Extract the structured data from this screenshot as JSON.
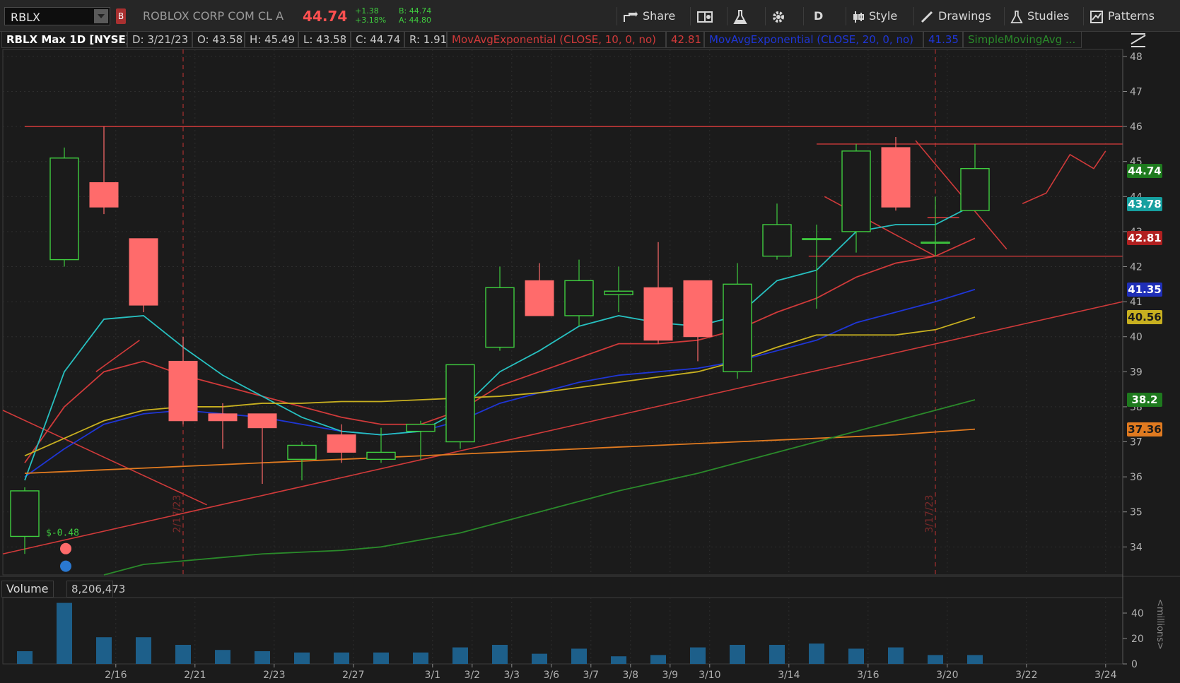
{
  "header": {
    "symbol": "RBLX",
    "badge": "B",
    "company": "ROBLOX CORP COM CL A",
    "last": "44.74",
    "change_abs": "+1.38",
    "change_pct": "+3.18%",
    "bid": "B: 44.74",
    "ask": "A: 44.80",
    "share_label": "Share",
    "period_label": "D",
    "style_label": "Style",
    "drawings_label": "Drawings",
    "studies_label": "Studies",
    "patterns_label": "Patterns"
  },
  "info": {
    "title": "RBLX Max 1D [NYSE]",
    "date": "D: 3/21/23",
    "open": "O: 43.58",
    "high": "H: 45.49",
    "low": "L: 43.58",
    "close": "C: 44.74",
    "range": "R: 1.91",
    "ema10": "MovAvgExponential (CLOSE, 10, 0, no)",
    "ema10_val": "42.81",
    "ema20": "MovAvgExponential (CLOSE, 20, 0, no)",
    "ema20_val": "41.35",
    "sma": "SimpleMovingAvg ..."
  },
  "volume": {
    "label": "Volume",
    "value": "8,206,473",
    "unit": "<millions>"
  },
  "colors": {
    "up": "#3fcc3f",
    "down": "#ff6b6b",
    "ema10": "#d03a3a",
    "ema20": "#1f36d6",
    "cyan": "#27c0c0",
    "sma_yellow": "#c8b020",
    "sma_orange": "#e07a20",
    "sma_green": "#2a8a2a",
    "volume": "#1d5f8a"
  },
  "chart_data": {
    "type": "candlestick",
    "ylim": [
      33.2,
      48.2
    ],
    "y_ticks": [
      34,
      35,
      36,
      37,
      38,
      39,
      40,
      41,
      42,
      43,
      44,
      45,
      46,
      47,
      48
    ],
    "x_labels": [
      {
        "i": 2.3,
        "label": "2/16"
      },
      {
        "i": 4.3,
        "label": "2/21"
      },
      {
        "i": 6.3,
        "label": "2/23"
      },
      {
        "i": 8.3,
        "label": "2/27"
      },
      {
        "i": 10.3,
        "label": "3/1"
      },
      {
        "i": 11.3,
        "label": "3/2"
      },
      {
        "i": 12.3,
        "label": "3/3"
      },
      {
        "i": 13.3,
        "label": "3/6"
      },
      {
        "i": 14.3,
        "label": "3/7"
      },
      {
        "i": 15.3,
        "label": "3/8"
      },
      {
        "i": 16.3,
        "label": "3/9"
      },
      {
        "i": 17.3,
        "label": "3/10"
      },
      {
        "i": 19.3,
        "label": "3/14"
      },
      {
        "i": 21.3,
        "label": "3/16"
      },
      {
        "i": 23.3,
        "label": "3/20"
      },
      {
        "i": 25.3,
        "label": "3/22"
      },
      {
        "i": 27.3,
        "label": "3/24"
      }
    ],
    "candles": [
      {
        "o": 34.3,
        "h": 35.7,
        "l": 33.8,
        "c": 35.6
      },
      {
        "o": 42.2,
        "h": 45.4,
        "l": 42.0,
        "c": 45.1
      },
      {
        "o": 44.4,
        "h": 46.0,
        "l": 43.5,
        "c": 43.7
      },
      {
        "o": 42.8,
        "h": 42.8,
        "l": 40.7,
        "c": 40.9
      },
      {
        "o": 39.3,
        "h": 40.0,
        "l": 37.5,
        "c": 37.6
      },
      {
        "o": 37.8,
        "h": 38.1,
        "l": 36.8,
        "c": 37.6
      },
      {
        "o": 37.8,
        "h": 37.8,
        "l": 35.8,
        "c": 37.4
      },
      {
        "o": 36.5,
        "h": 37.0,
        "l": 35.9,
        "c": 36.9
      },
      {
        "o": 37.2,
        "h": 37.5,
        "l": 36.4,
        "c": 36.7
      },
      {
        "o": 36.5,
        "h": 37.4,
        "l": 36.4,
        "c": 36.7
      },
      {
        "o": 37.3,
        "h": 37.6,
        "l": 36.5,
        "c": 37.5
      },
      {
        "o": 37.0,
        "h": 39.2,
        "l": 36.8,
        "c": 39.2
      },
      {
        "o": 39.7,
        "h": 42.0,
        "l": 39.6,
        "c": 41.4
      },
      {
        "o": 41.6,
        "h": 42.1,
        "l": 40.6,
        "c": 40.6
      },
      {
        "o": 40.6,
        "h": 42.2,
        "l": 40.3,
        "c": 41.6
      },
      {
        "o": 41.2,
        "h": 42.0,
        "l": 40.7,
        "c": 41.3
      },
      {
        "o": 41.4,
        "h": 42.7,
        "l": 39.8,
        "c": 39.9
      },
      {
        "o": 41.6,
        "h": 41.6,
        "l": 39.3,
        "c": 40.0
      },
      {
        "o": 39.0,
        "h": 42.1,
        "l": 38.8,
        "c": 41.5
      },
      {
        "o": 42.3,
        "h": 43.8,
        "l": 42.2,
        "c": 43.2
      },
      {
        "o": 42.8,
        "h": 43.2,
        "l": 40.8,
        "c": 42.8
      },
      {
        "o": 43.0,
        "h": 45.5,
        "l": 42.4,
        "c": 45.3
      },
      {
        "o": 45.4,
        "h": 45.7,
        "l": 43.6,
        "c": 43.7
      },
      {
        "o": 42.7,
        "h": 44.0,
        "l": 42.3,
        "c": 42.7
      },
      {
        "o": 43.6,
        "h": 45.5,
        "l": 43.6,
        "c": 44.8
      }
    ],
    "volume_ylim": [
      0,
      50
    ],
    "volume_ticks": [
      0,
      20,
      40
    ],
    "volumes": [
      10,
      48,
      21,
      21,
      15,
      11,
      10,
      9,
      9,
      9,
      9,
      13,
      15,
      8,
      12,
      6,
      7,
      13,
      15,
      15,
      16,
      12,
      13,
      7,
      7
    ],
    "series": [
      {
        "name": "ema10",
        "color": "#d03a3a",
        "values": [
          36.4,
          38.0,
          39.0,
          39.3,
          38.9,
          38.6,
          38.3,
          38.0,
          37.7,
          37.5,
          37.5,
          37.9,
          38.6,
          39.0,
          39.4,
          39.8,
          39.8,
          39.9,
          40.2,
          40.7,
          41.1,
          41.7,
          42.1,
          42.3,
          42.81
        ]
      },
      {
        "name": "ema20",
        "color": "#1f36d6",
        "values": [
          36.0,
          36.8,
          37.5,
          37.8,
          37.9,
          37.8,
          37.7,
          37.5,
          37.3,
          37.2,
          37.3,
          37.6,
          38.1,
          38.4,
          38.7,
          38.9,
          39.0,
          39.1,
          39.3,
          39.6,
          39.9,
          40.4,
          40.7,
          41.0,
          41.35
        ]
      },
      {
        "name": "cyan",
        "color": "#27c0c0",
        "values": [
          35.9,
          39.0,
          40.5,
          40.6,
          39.7,
          38.9,
          38.3,
          37.7,
          37.3,
          37.2,
          37.3,
          37.9,
          39.0,
          39.6,
          40.3,
          40.6,
          40.4,
          40.3,
          40.6,
          41.6,
          41.9,
          43.0,
          43.2,
          43.2,
          43.78
        ]
      },
      {
        "name": "sma-yellow",
        "color": "#c8b020",
        "values": [
          36.6,
          37.1,
          37.6,
          37.9,
          38.0,
          38.0,
          38.1,
          38.1,
          38.15,
          38.15,
          38.2,
          38.25,
          38.3,
          38.4,
          38.55,
          38.7,
          38.85,
          39.0,
          39.3,
          39.7,
          40.05,
          40.05,
          40.05,
          40.2,
          40.56
        ]
      },
      {
        "name": "sma-orange",
        "color": "#e07a20",
        "values": [
          36.1,
          36.15,
          36.2,
          36.25,
          36.3,
          36.35,
          36.4,
          36.45,
          36.5,
          36.55,
          36.6,
          36.65,
          36.7,
          36.75,
          36.8,
          36.85,
          36.9,
          36.95,
          37.0,
          37.05,
          37.1,
          37.15,
          37.2,
          37.28,
          37.36
        ]
      },
      {
        "name": "sma-green",
        "color": "#2a8a2a",
        "values": [
          null,
          null,
          33.2,
          33.5,
          33.6,
          33.7,
          33.8,
          33.85,
          33.9,
          34.0,
          34.2,
          34.4,
          34.7,
          35.0,
          35.3,
          35.6,
          35.85,
          36.1,
          36.4,
          36.7,
          37.0,
          37.3,
          37.6,
          37.9,
          38.2
        ]
      }
    ],
    "vertical_markers": [
      {
        "i": 4.0,
        "label": "2/17/23"
      },
      {
        "i": 23.0,
        "label": "3/17/23"
      }
    ],
    "price_tags": [
      {
        "value": "44.74",
        "y": 44.74,
        "bg": "#1e7a1e",
        "fg": "#ffffff"
      },
      {
        "value": "43.78",
        "y": 43.78,
        "bg": "#16a0a0",
        "fg": "#ffffff"
      },
      {
        "value": "42.81",
        "y": 42.81,
        "bg": "#b02020",
        "fg": "#ffffff"
      },
      {
        "value": "41.35",
        "y": 41.35,
        "bg": "#1f2fb8",
        "fg": "#ffffff"
      },
      {
        "value": "40.56",
        "y": 40.56,
        "bg": "#c8b020",
        "fg": "#1b1b1b"
      },
      {
        "value": "38.2",
        "y": 38.2,
        "bg": "#1e7a1e",
        "fg": "#ffffff"
      },
      {
        "value": "37.36",
        "y": 37.36,
        "bg": "#e07a20",
        "fg": "#1b1b1b"
      }
    ],
    "annotations": [
      {
        "text": "$-0.48",
        "i": 1.0,
        "y": 34.3,
        "color": "#3fcc3f"
      }
    ]
  }
}
